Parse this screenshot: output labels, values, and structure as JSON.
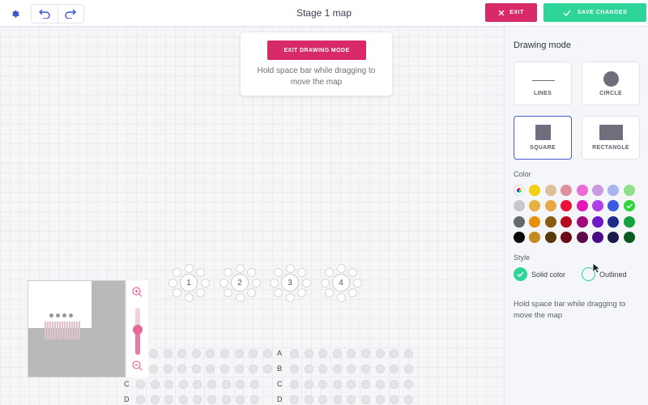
{
  "header": {
    "title": "Stage 1 map",
    "exit_label": "EXIT",
    "save_label": "SAVE CHANGES",
    "icons": [
      "gear-icon",
      "undo-icon",
      "redo-icon"
    ]
  },
  "canvas": {
    "exit_drawing_label": "EXIT DRAWING MODE",
    "drawing_hint": "Hold space bar while dragging to move the map",
    "tables": [
      "1",
      "2",
      "3",
      "4"
    ],
    "row_labels": [
      "A",
      "B",
      "C",
      "D"
    ]
  },
  "panel": {
    "title": "Drawing mode",
    "shapes": [
      {
        "label": "LINES",
        "icon": "line-icon",
        "selected": false
      },
      {
        "label": "CIRCLE",
        "icon": "circle-icon",
        "selected": false
      },
      {
        "label": "SQUARE",
        "icon": "square-icon",
        "selected": true
      },
      {
        "label": "RECTANGLE",
        "icon": "rectangle-icon",
        "selected": false
      }
    ],
    "color_label": "Color",
    "colors": [
      [
        "rainbow",
        "#f2d00f",
        "#dcc09a",
        "#e08fa0",
        "#ec6ad8",
        "#c89ae0",
        "#aab4ee",
        "#8ee08a"
      ],
      [
        "#c8c8cc",
        "#e8b040",
        "#e7a84a",
        "#e8123a",
        "#e417b8",
        "#b13ee6",
        "#3a5ae0",
        "#2ed53a"
      ],
      [
        "#666870",
        "#e8900a",
        "#8a5a14",
        "#b80a1e",
        "#a00a7a",
        "#6e18c8",
        "#1e2a8a",
        "#16a040"
      ],
      [
        "#0a0a0a",
        "#c78a20",
        "#5a3a0a",
        "#6e0a14",
        "#5e0a4a",
        "#4a0a8a",
        "#1a1a4a",
        "#0a5a20"
      ]
    ],
    "selected_color": "#2ed53a",
    "style_label": "Style",
    "style_options": [
      {
        "label": "Solid color",
        "selected": true
      },
      {
        "label": "Outlined",
        "selected": false
      }
    ],
    "hint": "Hold space bar while dragging to move the map"
  }
}
